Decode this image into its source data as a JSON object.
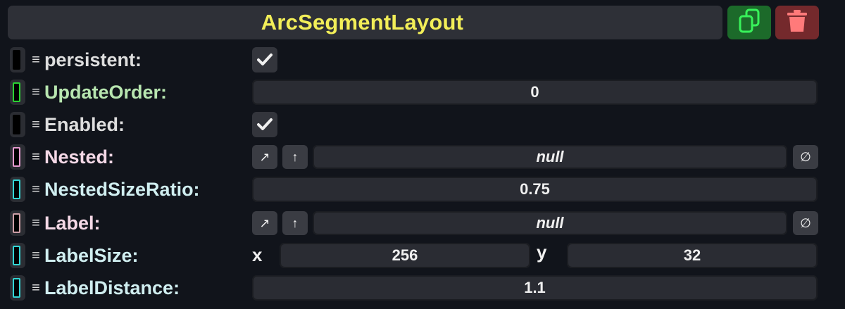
{
  "header": {
    "title": "ArcSegmentLayout",
    "duplicate_icon": "duplicate-icon",
    "delete_icon": "trash-icon"
  },
  "colors": {
    "title": "#f2ee58",
    "label_default": "#dedede",
    "label_green": "#b8e6b0",
    "label_pink": "#f4d8e6",
    "label_cyan": "#d0eef0"
  },
  "fields": {
    "persistent": {
      "label": "persistent:",
      "checked": true
    },
    "update_order": {
      "label": "UpdateOrder:",
      "value": "0"
    },
    "enabled": {
      "label": "Enabled:",
      "checked": true
    },
    "nested": {
      "label": "Nested:",
      "value": "null",
      "btn_a": "↗",
      "btn_b": "↑",
      "clear": "∅"
    },
    "nested_size_ratio": {
      "label": "NestedSizeRatio:",
      "value": "0.75"
    },
    "label": {
      "label": "Label:",
      "value": "null",
      "btn_a": "↗",
      "btn_b": "↑",
      "clear": "∅"
    },
    "label_size": {
      "label": "LabelSize:",
      "x_label": "x",
      "x": "256",
      "y_label": "y",
      "y": "32"
    },
    "label_distance": {
      "label": "LabelDistance:",
      "value": "1.1"
    }
  }
}
